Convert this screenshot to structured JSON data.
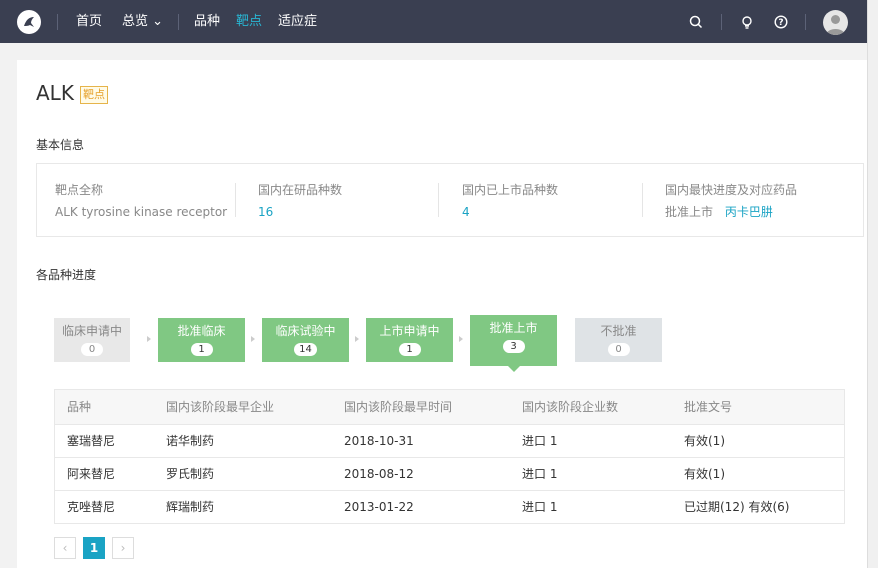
{
  "nav": {
    "items": [
      {
        "label": "首页"
      },
      {
        "label": "总览 ⌄"
      },
      {
        "label": "品种"
      },
      {
        "label": "靶点"
      },
      {
        "label": "适应症"
      }
    ],
    "active_color": "#29b6d3",
    "background": "#3a3f51",
    "icons": [
      "logo-icon",
      "search-icon",
      "lightbulb-icon",
      "help-icon",
      "avatar-icon"
    ]
  },
  "page": {
    "title": "ALK",
    "tag": "靶点"
  },
  "basic_info": {
    "heading": "基本信息",
    "fields": [
      {
        "label": "靶点全称",
        "value": "ALK tyrosine kinase receptor"
      },
      {
        "label": "国内在研品种数",
        "value": "16"
      },
      {
        "label": "国内已上市品种数",
        "value": "4"
      },
      {
        "label": "国内最快进度及对应药品",
        "value_prefix": "批准上市",
        "value": "丙卡巴肼"
      }
    ]
  },
  "progress": {
    "heading": "各品种进度",
    "stages": [
      {
        "label": "临床申请中",
        "count": "0"
      },
      {
        "label": "批准临床",
        "count": "1"
      },
      {
        "label": "临床试验中",
        "count": "14"
      },
      {
        "label": "上市申请中",
        "count": "1"
      },
      {
        "label": "批准上市",
        "count": "3"
      },
      {
        "label": "不批准",
        "count": "0"
      }
    ],
    "active_stage": "批准上市"
  },
  "table": {
    "columns": [
      "品种",
      "国内该阶段最早企业",
      "国内该阶段最早时间",
      "国内该阶段企业数",
      "批准文号"
    ],
    "rows": [
      {
        "drug": "塞瑞替尼",
        "company": "诺华制药",
        "date": "2018-10-31",
        "count": "进口 1",
        "approval": "有效(1)"
      },
      {
        "drug": "阿来替尼",
        "company": "罗氏制药",
        "date": "2018-08-12",
        "count": "进口 1",
        "approval": "有效(1)"
      },
      {
        "drug": "克唑替尼",
        "company": "辉瑞制药",
        "date": "2013-01-22",
        "count": "进口 1",
        "approval": "已过期(12) 有效(6)"
      }
    ]
  },
  "pagination": {
    "prev": "‹",
    "current": "1",
    "next": "›"
  },
  "colors": {
    "link": "#1aa3c4",
    "stage_green": "#80c883",
    "stage_gray": "#e8e8e8",
    "tag_border": "#e6b44a"
  }
}
